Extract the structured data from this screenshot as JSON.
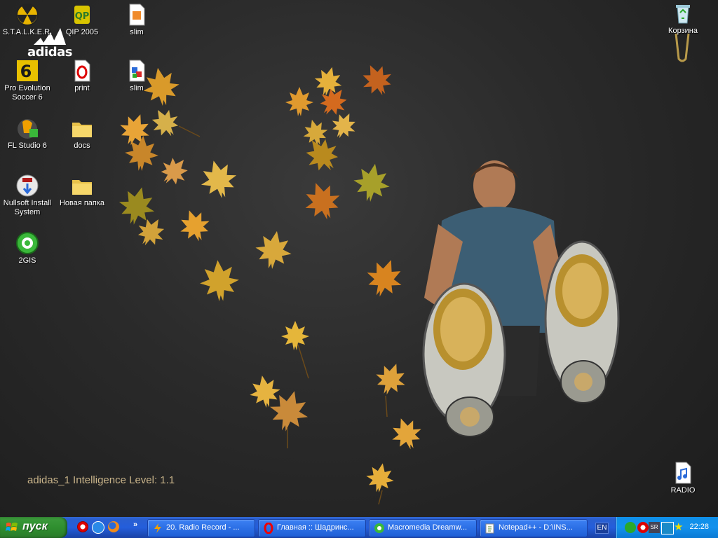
{
  "desktop": {
    "icons": [
      {
        "label": "S.T.A.L.K.E.R."
      },
      {
        "label": "QIP 2005"
      },
      {
        "label": "slim"
      },
      {
        "label": "Pro Evolution Soccer 6"
      },
      {
        "label": "print"
      },
      {
        "label": "slim"
      },
      {
        "label": "FL Studio 6"
      },
      {
        "label": "docs"
      },
      {
        "label": "Nullsoft Install System"
      },
      {
        "label": "Новая папка"
      },
      {
        "label": "2GIS"
      },
      {
        "label": "Корзина"
      },
      {
        "label": "RADIO"
      }
    ],
    "logo_text": "adidas",
    "wallpaper_caption": "adidas_1 Intelligence Level: 1.1"
  },
  "taskbar": {
    "start_label": "пуск",
    "tasks": [
      {
        "label": "20. Radio Record - ..."
      },
      {
        "label": "Главная :: Шадринс..."
      },
      {
        "label": "Macromedia Dreamw..."
      },
      {
        "label": "Notepad++ - D:\\INS..."
      }
    ],
    "language": "EN",
    "clock": "22:28"
  },
  "colors": {
    "taskbar": "#245edb",
    "start": "#2f8f2f",
    "tray": "#1391ec",
    "caption": "#c9b48a"
  }
}
